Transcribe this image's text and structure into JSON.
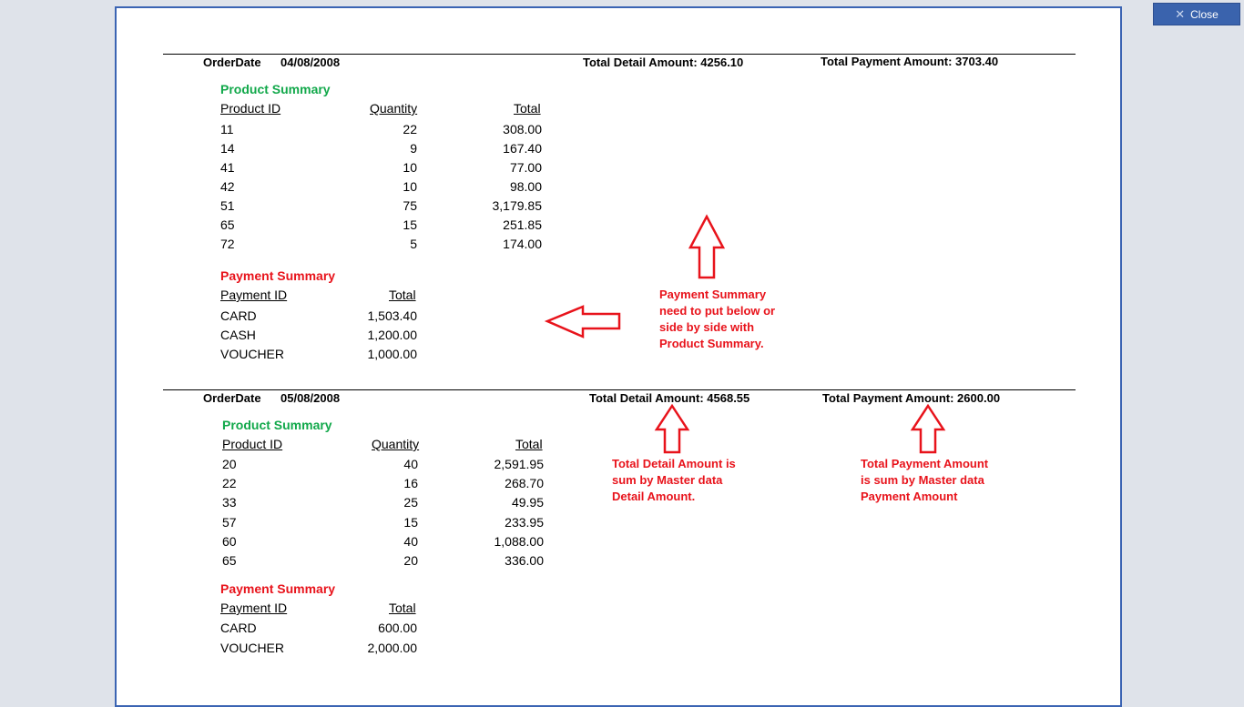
{
  "close_button": {
    "label": "Close"
  },
  "orders": [
    {
      "order_date_label": "OrderDate",
      "order_date": "04/08/2008",
      "detail_total_text": "Total Detail Amount: 4256.10",
      "payment_total_text": "Total Payment Amount: 3703.40",
      "product_summary": {
        "title": "Product Summary",
        "columns": [
          "Product ID",
          "Quantity",
          "Total"
        ],
        "rows": [
          [
            "11",
            "22",
            "308.00"
          ],
          [
            "14",
            "9",
            "167.40"
          ],
          [
            "41",
            "10",
            "77.00"
          ],
          [
            "42",
            "10",
            "98.00"
          ],
          [
            "51",
            "75",
            "3,179.85"
          ],
          [
            "65",
            "15",
            "251.85"
          ],
          [
            "72",
            "5",
            "174.00"
          ]
        ]
      },
      "payment_summary": {
        "title": "Payment Summary",
        "columns": [
          "Payment ID",
          "Total"
        ],
        "rows": [
          [
            "CARD",
            "1,503.40"
          ],
          [
            "CASH",
            "1,200.00"
          ],
          [
            "VOUCHER",
            "1,000.00"
          ]
        ]
      }
    },
    {
      "order_date_label": "OrderDate",
      "order_date": "05/08/2008",
      "detail_total_text": "Total Detail Amount: 4568.55",
      "payment_total_text": "Total Payment Amount: 2600.00",
      "product_summary": {
        "title": "Product Summary",
        "columns": [
          "Product ID",
          "Quantity",
          "Total"
        ],
        "rows": [
          [
            "20",
            "40",
            "2,591.95"
          ],
          [
            "22",
            "16",
            "268.70"
          ],
          [
            "33",
            "25",
            "49.95"
          ],
          [
            "57",
            "15",
            "233.95"
          ],
          [
            "60",
            "40",
            "1,088.00"
          ],
          [
            "65",
            "20",
            "336.00"
          ]
        ]
      },
      "payment_summary": {
        "title": "Payment Summary",
        "columns": [
          "Payment ID",
          "Total"
        ],
        "rows": [
          [
            "CARD",
            "600.00"
          ],
          [
            "VOUCHER",
            "2,000.00"
          ]
        ]
      }
    }
  ],
  "annotations": {
    "payment_layout": [
      "Payment Summary",
      "need to put below or",
      "side by side with",
      "Product Summary."
    ],
    "detail_amount": [
      "Total Detail Amount is",
      "sum by Master data",
      "Detail Amount."
    ],
    "payment_amount": [
      "Total Payment Amount",
      "is sum by Master data",
      "Payment Amount"
    ]
  },
  "colors": {
    "annotation": "#e8131b",
    "product_title": "#11a84a",
    "payment_title": "#e8131b",
    "frame": "#3b64b3"
  }
}
